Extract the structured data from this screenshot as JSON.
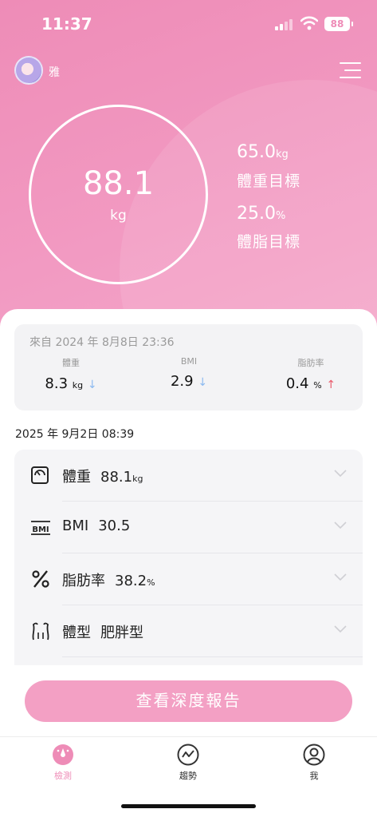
{
  "status": {
    "time": "11:37",
    "battery": "88"
  },
  "user": {
    "name": "雅",
    "avatar_icon": "user-avatar-photo"
  },
  "header": {
    "menu_icon": "hamburger-menu-icon"
  },
  "hero": {
    "weight": "88.1",
    "weight_unit": "kg",
    "goals": [
      {
        "value": "65.0",
        "unit": "kg",
        "label": "體重目標"
      },
      {
        "value": "25.0",
        "unit": "%",
        "label": "體脂目標"
      }
    ]
  },
  "comparison": {
    "source": "來自 2024 年 8月8日 23:36",
    "items": [
      {
        "label": "體重",
        "value": "8.3",
        "unit": "kg",
        "arrow": "↓",
        "direction": "down"
      },
      {
        "label": "BMI",
        "value": "2.9",
        "unit": "",
        "arrow": "↓",
        "direction": "down"
      },
      {
        "label": "脂肪率",
        "value": "0.4",
        "unit": "%",
        "arrow": "↑",
        "direction": "up"
      }
    ]
  },
  "measurement": {
    "date": "2025 年 9月2日 08:39",
    "metrics": [
      {
        "icon": "scale-icon",
        "name": "體重",
        "value": "88.1",
        "unit": "kg"
      },
      {
        "icon": "bmi-icon",
        "name": "BMI",
        "value": "30.5",
        "unit": ""
      },
      {
        "icon": "percent-icon",
        "name": "脂肪率",
        "value": "38.2",
        "unit": "%"
      },
      {
        "icon": "body-shape-icon",
        "name": "體型",
        "value": "肥胖型",
        "unit": ""
      }
    ]
  },
  "actions": {
    "report_label": "查看深度報告"
  },
  "tabs": [
    {
      "label": "檢測",
      "icon": "measure-icon",
      "active": true
    },
    {
      "label": "趨勢",
      "icon": "trend-icon",
      "active": false
    },
    {
      "label": "我",
      "icon": "profile-icon",
      "active": false
    }
  ],
  "colors": {
    "brand_pink": "#ee8cb7",
    "button_pink": "#f3a0c4",
    "down_arrow": "#8cbaf0",
    "up_arrow": "#ea5b6c"
  }
}
